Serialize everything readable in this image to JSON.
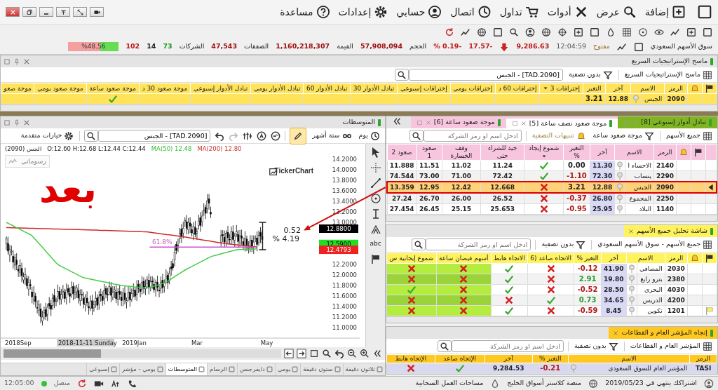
{
  "menu": [
    "إضافة",
    "عرض",
    "أدوات",
    "تداول",
    "اتصال",
    "حسابي",
    "إعدادات",
    "مساعدة"
  ],
  "market": {
    "name": "سوق الأسهم السعودي",
    "status": "مفتوح",
    "time": "12:04:59",
    "index": "9,286.63",
    "falling": true,
    "change": "-17.57",
    "change_percent": "-0.19 %",
    "stats": [
      {
        "label": "الحجم",
        "value": "57,908,094"
      },
      {
        "label": "القيمة",
        "value": "1,160,218,307"
      },
      {
        "label": "الصفقات",
        "value": "47,543"
      }
    ],
    "companies": {
      "label": "الشركات",
      "up": "73",
      "unchanged": "14",
      "down": "102"
    },
    "breadth": {
      "text": "%48.56",
      "level": 0.36
    }
  },
  "scanner": {
    "title": "ماسح الإستراتيجيات السريع",
    "toolbar": {
      "list": "ماسح الإستراتيجيات السريع",
      "filter": "بدون تصفية",
      "search": "[TAD.2090] - الجبس"
    },
    "table": {
      "show_crosses": false,
      "columns": [
        {
          "label": "الرمز",
          "kind": "text",
          "sorted": false
        },
        {
          "label": "الاسم",
          "kind": "name",
          "sorted": false
        },
        {
          "label": "آخر",
          "kind": "last",
          "sorted": false
        },
        {
          "label": "التغير",
          "kind": "change",
          "sorted": false
        },
        {
          "label": "إختراقات 3",
          "kind": "mark",
          "sorted": true
        },
        {
          "label": "إختراقات 60 د",
          "kind": "mark",
          "sorted": false
        },
        {
          "label": "إختراقات يومي",
          "kind": "mark",
          "sorted": false
        },
        {
          "label": "إختراقات إسبوعي",
          "kind": "mark",
          "sorted": false
        },
        {
          "label": "تبادل الأدوار 30",
          "kind": "mark",
          "sorted": false
        },
        {
          "label": "تبادل الأدوار 60",
          "kind": "mark",
          "sorted": false
        },
        {
          "label": "تبادل الأدوار يومي",
          "kind": "mark",
          "sorted": false
        },
        {
          "label": "تبادل الأدوار إسبوعي",
          "kind": "mark",
          "sorted": false
        },
        {
          "label": "موجة صعود 30 د",
          "kind": "mark",
          "sorted": false
        },
        {
          "label": "موجة صعود ساعة",
          "kind": "mark",
          "sorted": false
        },
        {
          "label": "موجة صعود يومي",
          "kind": "mark",
          "sorted": false
        },
        {
          "label": "موجة صعو",
          "kind": "mark",
          "sorted": false
        }
      ],
      "rows": [
        {
          "cells": [
            "2090",
            "الجبس",
            "12.88",
            "3.21",
            false,
            false,
            false,
            false,
            false,
            false,
            false,
            false,
            false,
            true,
            false,
            false
          ],
          "color": "#222222",
          "flash": false,
          "selected": true,
          "flagged": false
        }
      ]
    }
  },
  "chart_panel": {
    "title": "المتوسطات",
    "interval": "يوم",
    "range": "ستة أشهر",
    "search": "[TAD.2090] - الجبس",
    "options": "خيارات متقدمة",
    "legend": {
      "symbol": "الجس (2090)",
      "ohlc": "O:12.60 H:12.68 L:12.44 C:12.44",
      "ma50_label": "MA(50)",
      "ma50": "12.48",
      "ma200_label": "MA(200)",
      "ma200": "12.80"
    },
    "drawings_button": "رسوماتي",
    "logo": "TickerChart",
    "annotation": "بعد",
    "tool_label": "abc",
    "price_ticks": [
      "14.2000",
      "14.0000",
      "13.8000",
      "13.6000",
      "13.4000",
      "13.2000",
      "13.0000",
      "12.2000",
      "12.0000",
      "11.8000",
      "11.6000",
      "11.4000",
      "11.2000",
      "11.0000"
    ],
    "price_labels": [
      {
        "text": "12.8800",
        "color": "#000000"
      },
      {
        "text": "12.5900",
        "color": "#22dd22"
      },
      {
        "text": "12.4793",
        "color": "#ee2222"
      }
    ],
    "measure": {
      "value": "0.52",
      "percent": "% 4.19"
    },
    "fib_label": "61.8%",
    "time_labels": [
      "May",
      "Mar",
      "2019Jan",
      "2018Sep"
    ],
    "hover_date": "2018-11-11 Sunday",
    "tabs": [
      {
        "label": "ثلاثون دقيقة",
        "selected": false
      },
      {
        "label": "ستون دقيقة",
        "selected": false
      },
      {
        "label": "يومي",
        "selected": false
      },
      {
        "label": "دايفرجنس",
        "selected": false
      },
      {
        "label": "الرسام",
        "selected": false
      },
      {
        "label": "المتوسطات",
        "selected": true
      },
      {
        "label": "يومي - مؤشر",
        "selected": false
      },
      {
        "label": "إسبوعي",
        "selected": false
      }
    ]
  },
  "panes": [
    {
      "kind": "tabs",
      "tabs": [
        {
          "label": "تبادل أدوار إسبوعي [8]",
          "color": "#7fb522",
          "selected": false
        },
        {
          "label": "موجة صعود نصف ساعة [5]",
          "color": "#f7c6de",
          "selected": true
        },
        {
          "label": "موجة صعود ساعة [6]",
          "color": "#f7c6de",
          "selected": false
        }
      ],
      "toolbar": {
        "list": "جميع الأسهم",
        "filter": "موجة صعود ساعة",
        "alerts": "تنبيهات التصفية",
        "placeholder": "ادخل اسم او رمز الشركة"
      },
      "table": {
        "show_crosses": true,
        "columns": [
          {
            "label": "الرمز",
            "kind": "text",
            "sorted": false
          },
          {
            "label": "الاسم",
            "kind": "name",
            "sorted": false
          },
          {
            "label": "آخر",
            "kind": "last",
            "sorted": false
          },
          {
            "label": "التغير %",
            "kind": "change",
            "sorted": false
          },
          {
            "label": "شموع إيجاد",
            "kind": "mark",
            "sorted": true
          },
          {
            "label": "جيد للشراء حتى",
            "kind": "value",
            "sorted": false
          },
          {
            "label": "وقف الخسارة",
            "kind": "value",
            "sorted": false
          },
          {
            "label": "صعود 1",
            "kind": "value",
            "sorted": false
          },
          {
            "label": "صعود 2",
            "kind": "value",
            "sorted": false
          }
        ],
        "rows": [
          {
            "cells": [
              "2140",
              "الاحساء ا",
              "11.30",
              "0.00",
              true,
              "11.24",
              "11.02",
              "11.51",
              "11.888"
            ],
            "color": "#222222",
            "flash": true,
            "selected": false,
            "flagged": false,
            "outlined": false
          },
          {
            "cells": [
              "2290",
              "ينساب",
              "72.30",
              "1.10-",
              true,
              "72.42",
              "71.00",
              "73.00",
              "74.544"
            ],
            "color": "#b01818",
            "flash": true,
            "selected": false,
            "flagged": false,
            "outlined": false
          },
          {
            "cells": [
              "2090",
              "الجبس",
              "12.88",
              "3.21",
              false,
              "12.668",
              "12.42",
              "12.95",
              "13.359"
            ],
            "color": "#222222",
            "flash": false,
            "selected": true,
            "flagged": false,
            "outlined": true
          },
          {
            "cells": [
              "2250",
              "المجموع",
              "26.80",
              "0.37-",
              false,
              "26.52",
              "26.00",
              "26.70",
              "27.24"
            ],
            "color": "#b01818",
            "flash": true,
            "selected": false,
            "flagged": false,
            "outlined": false
          },
          {
            "cells": [
              "1140",
              "البلاد",
              "25.95",
              "0.95-",
              false,
              "25.653",
              "25.15",
              "26.45",
              "27.454"
            ],
            "color": "#b01818",
            "flash": true,
            "selected": false,
            "flagged": false,
            "outlined": false
          }
        ]
      }
    },
    {
      "kind": "single",
      "title": "شاشة تحليل جميع الأسهم",
      "color": "#fff35c",
      "toolbar": {
        "list": "جميع الأسهم - سوق الأسهم السعودي",
        "filter": "بدون تصفية",
        "placeholder": "ادخل اسم او رمز الشركة"
      },
      "table": {
        "show_crosses": true,
        "columns": [
          {
            "label": "الرمز",
            "kind": "text"
          },
          {
            "label": "الاسم",
            "kind": "name"
          },
          {
            "label": "آخر",
            "kind": "last"
          },
          {
            "label": "التغير %",
            "kind": "change"
          },
          {
            "label": "الاتجاه صاعد (6",
            "kind": "mark"
          },
          {
            "label": "الاتجاه هابط",
            "kind": "mark"
          },
          {
            "label": "أسهم فيضان ساعة",
            "kind": "tinted-mark"
          },
          {
            "label": "شموع إيجابية س",
            "kind": "tinted-mark"
          }
        ],
        "rows": [
          {
            "cells": [
              "2030",
              "المصافي",
              "41.90",
              "0.12-",
              false,
              true,
              false,
              false
            ],
            "color": "#b01818",
            "flash": true,
            "selected": false,
            "flagged": false
          },
          {
            "cells": [
              "2380",
              "بترو رابغ",
              "19.80",
              "2.91",
              false,
              true,
              false,
              false
            ],
            "color": "#2a9a2a",
            "flash": true,
            "selected": false,
            "flagged": false
          },
          {
            "cells": [
              "4030",
              "البحري",
              "28.50",
              "0.52-",
              false,
              true,
              false,
              true
            ],
            "color": "#b01818",
            "flash": true,
            "selected": false,
            "flagged": false
          },
          {
            "cells": [
              "4200",
              "الدريس",
              "34.65",
              "0.73",
              true,
              false,
              false,
              false
            ],
            "color": "#2a9a2a",
            "flash": true,
            "selected": false,
            "flagged": false
          },
          {
            "cells": [
              "1201",
              "تكوين",
              "8.45",
              "0.59-",
              false,
              true,
              false,
              false
            ],
            "color": "#b01818",
            "flash": true,
            "selected": false,
            "flagged": true
          }
        ]
      }
    },
    {
      "kind": "single",
      "title": "إتجاه المؤشر العام و القطاعات",
      "color": "#ffc81e",
      "toolbar": {
        "list": "المؤشر العام و القطاعات",
        "filter": "بدون تصفية",
        "placeholder": "ادخل اسم او رمز الشركة"
      },
      "table": {
        "show_crosses": true,
        "columns": [
          {
            "label": "الرمز",
            "kind": "text"
          },
          {
            "label": "الاسم",
            "kind": "name"
          },
          {
            "label": "التغير %",
            "kind": "change"
          },
          {
            "label": "آخر",
            "kind": "value"
          },
          {
            "label": "الإتجاه صاعد",
            "kind": "mark"
          },
          {
            "label": "الإتجاه هابط",
            "kind": "mark"
          }
        ],
        "rows": [
          {
            "cells": [
              "TASI",
              "المؤشر العام للسوق السعودي",
              "0.21-",
              "9,284.53",
              true,
              false
            ],
            "color": "#b01818",
            "selected": true
          }
        ]
      }
    }
  ],
  "status_bar": {
    "subscription": "اشتراكك ينتهي في 2019/05/23",
    "platform": "منصة كلاستر أسواق الخليج",
    "workspaces": "مساحات العمل السحابية",
    "connection": "متصل",
    "connected": true,
    "time": "12:05:00"
  }
}
